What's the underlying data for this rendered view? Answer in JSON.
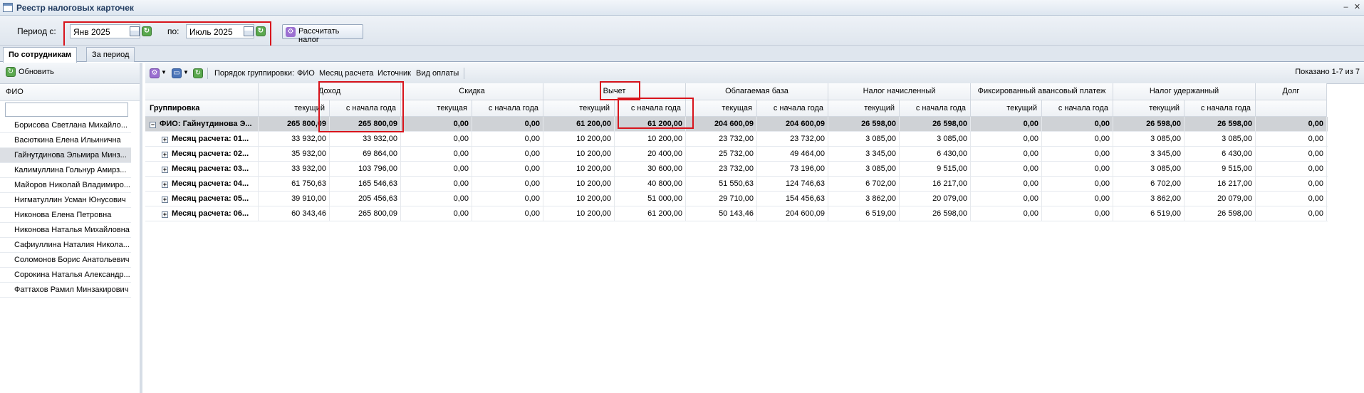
{
  "window": {
    "title": "Реестр налоговых карточек",
    "minimize": "‒",
    "close": "✕"
  },
  "period": {
    "from_label": "Период с:",
    "from_value": "Янв 2025",
    "to_label": "по:",
    "to_value": "Июль 2025",
    "calc_button": "Рассчитать налог"
  },
  "tabs": [
    {
      "label": "По сотрудникам",
      "active": true
    },
    {
      "label": "За период",
      "active": false
    }
  ],
  "left": {
    "refresh": "Обновить",
    "column": "ФИО",
    "filter_value": "",
    "employees": [
      "Борисова Светлана Михайло...",
      "Васюткина Елена Ильинична",
      "Гайнутдинова Эльмира Минз...",
      "Калимуллина Гольнур Амирз...",
      "Майоров Николай Владимиро...",
      "Нигматуллин Усман Юнусович",
      "Никонова Елена Петровна",
      "Никонова Наталья Михайловна",
      "Сафиуллина Наталия Никола...",
      "Соломонов Борис Анатольевич",
      "Сорокина Наталья Александр...",
      "Фаттахов Рамил Минзакирович"
    ],
    "selected_index": 2
  },
  "toolbar": {
    "group_order_label": "Порядок группировки:",
    "group_fields": [
      "ФИО",
      "Месяц расчета",
      "Источник",
      "Вид оплаты"
    ],
    "shown": "Показано 1-7 из 7"
  },
  "grid": {
    "grouping_header": "Группировка",
    "groups": [
      "Доход",
      "Скидка",
      "Вычет",
      "Облагаемая база",
      "Налог начисленный",
      "Фиксированный авансовый платеж",
      "Налог удержанный"
    ],
    "debt_header": "Долг",
    "sub_headers": [
      "текущий",
      "с начала года",
      "текущая",
      "с начала года",
      "текущий",
      "с начала года",
      "текущая",
      "с начала года",
      "текущий",
      "с начала года",
      "текущий",
      "с начала года",
      "текущий",
      "с начала года"
    ],
    "group_row": {
      "label": "ФИО: Гайнутдинова Э...",
      "values": [
        "265 800,09",
        "265 800,09",
        "0,00",
        "0,00",
        "61 200,00",
        "61 200,00",
        "204 600,09",
        "204 600,09",
        "26 598,00",
        "26 598,00",
        "0,00",
        "0,00",
        "26 598,00",
        "26 598,00",
        "0,00"
      ]
    },
    "rows": [
      {
        "label": "Месяц расчета: 01...",
        "values": [
          "33 932,00",
          "33 932,00",
          "0,00",
          "0,00",
          "10 200,00",
          "10 200,00",
          "23 732,00",
          "23 732,00",
          "3 085,00",
          "3 085,00",
          "0,00",
          "0,00",
          "3 085,00",
          "3 085,00",
          "0,00"
        ]
      },
      {
        "label": "Месяц расчета: 02...",
        "values": [
          "35 932,00",
          "69 864,00",
          "0,00",
          "0,00",
          "10 200,00",
          "20 400,00",
          "25 732,00",
          "49 464,00",
          "3 345,00",
          "6 430,00",
          "0,00",
          "0,00",
          "3 345,00",
          "6 430,00",
          "0,00"
        ]
      },
      {
        "label": "Месяц расчета: 03...",
        "values": [
          "33 932,00",
          "103 796,00",
          "0,00",
          "0,00",
          "10 200,00",
          "30 600,00",
          "23 732,00",
          "73 196,00",
          "3 085,00",
          "9 515,00",
          "0,00",
          "0,00",
          "3 085,00",
          "9 515,00",
          "0,00"
        ]
      },
      {
        "label": "Месяц расчета: 04...",
        "values": [
          "61 750,63",
          "165 546,63",
          "0,00",
          "0,00",
          "10 200,00",
          "40 800,00",
          "51 550,63",
          "124 746,63",
          "6 702,00",
          "16 217,00",
          "0,00",
          "0,00",
          "6 702,00",
          "16 217,00",
          "0,00"
        ]
      },
      {
        "label": "Месяц расчета: 05...",
        "values": [
          "39 910,00",
          "205 456,63",
          "0,00",
          "0,00",
          "10 200,00",
          "51 000,00",
          "29 710,00",
          "154 456,63",
          "3 862,00",
          "20 079,00",
          "0,00",
          "0,00",
          "3 862,00",
          "20 079,00",
          "0,00"
        ]
      },
      {
        "label": "Месяц расчета: 06...",
        "values": [
          "60 343,46",
          "265 800,09",
          "0,00",
          "0,00",
          "10 200,00",
          "61 200,00",
          "50 143,46",
          "204 600,09",
          "6 519,00",
          "26 598,00",
          "0,00",
          "0,00",
          "6 519,00",
          "26 598,00",
          "0,00"
        ]
      }
    ]
  },
  "colors": {
    "highlight": "#d8141c",
    "group_row": "#cfd2d6",
    "selected": "#dcdfe4"
  }
}
